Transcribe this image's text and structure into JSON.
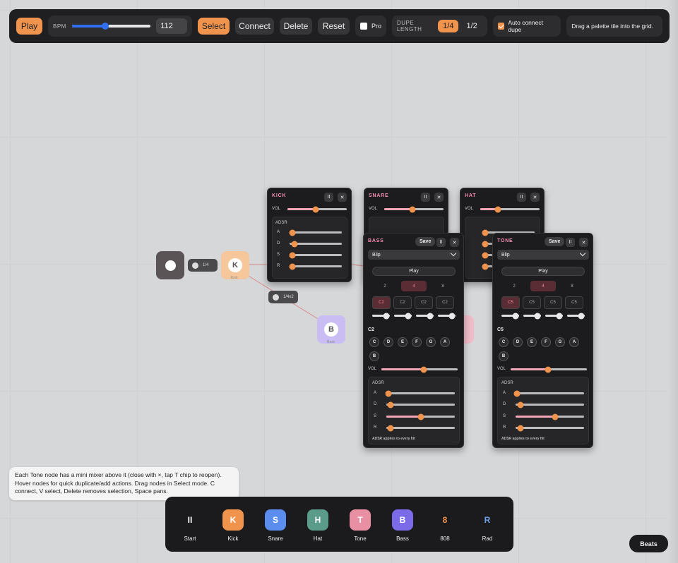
{
  "toolbar": {
    "play_label": "Play",
    "bpm_label": "BPM",
    "bpm_value": "112",
    "bpm_slider_fraction": 0.42,
    "select_label": "Select",
    "connect_label": "Connect",
    "delete_label": "Delete",
    "reset_label": "Reset",
    "pro_label": "Pro",
    "pro_checked": false,
    "dupe_length_label": "DUPE LENGTH",
    "dupe_options": [
      "1/4",
      "1/2"
    ],
    "dupe_selected": "1/4",
    "auto_connect_label": "Auto connect dupe",
    "auto_connect_checked": true,
    "hint_label": "Drag a palette tile into the grid."
  },
  "graph": {
    "start_node_label": "",
    "kick_node_letter": "K",
    "kick_node_label": "Kick",
    "bass_node_letter": "B",
    "bass_node_label": "Bass",
    "chip1_label": "1/4",
    "chip2_label": "1/4x2"
  },
  "mixers": {
    "kick": {
      "title": "KICK",
      "pause": "II",
      "close": "✕",
      "vol_label": "VOL",
      "vol": 0.48,
      "adsr_label": "ADSR",
      "a_label": "A",
      "d_label": "D",
      "s_label": "S",
      "r_label": "R",
      "a": 0.05,
      "d": 0.1,
      "s": 0.05,
      "r": 0.05
    },
    "snare": {
      "title": "SNARE",
      "pause": "II",
      "close": "✕",
      "vol_label": "VOL",
      "vol": 0.48
    },
    "hat": {
      "title": "HAT",
      "pause": "II",
      "close": "✕",
      "vol_label": "VOL",
      "vol": 0.3
    },
    "bass": {
      "title": "BASS",
      "save": "Save",
      "pause": "II",
      "close": "✕",
      "preset": "Blip",
      "play": "Play",
      "lengths": [
        "2",
        "4",
        "8"
      ],
      "length_selected": "4",
      "steps": [
        "C2",
        "C2",
        "C2",
        "C2"
      ],
      "step_active": 0,
      "pitch": "C2",
      "notes": [
        "C",
        "D",
        "E",
        "F",
        "G",
        "A",
        "B"
      ],
      "vol_label": "VOL",
      "vol": 0.56,
      "adsr_label": "ADSR",
      "a_label": "A",
      "d_label": "D",
      "s_label": "S",
      "r_label": "R",
      "a": 0.03,
      "d": 0.06,
      "s": 0.5,
      "r": 0.06,
      "footer": "ADSR applies to every hit"
    },
    "tone": {
      "title": "TONE",
      "save": "Save",
      "pause": "II",
      "close": "✕",
      "preset": "Blip",
      "play": "Play",
      "lengths": [
        "2",
        "4",
        "8"
      ],
      "length_selected": "4",
      "steps": [
        "C5",
        "C5",
        "C5",
        "C5"
      ],
      "step_active": 0,
      "pitch": "C5",
      "notes": [
        "C",
        "D",
        "E",
        "F",
        "G",
        "A",
        "B"
      ],
      "vol_label": "VOL",
      "vol": 0.49,
      "adsr_label": "ADSR",
      "a_label": "A",
      "d_label": "D",
      "s_label": "S",
      "r_label": "R",
      "a": 0.02,
      "d": 0.07,
      "s": 0.58,
      "r": 0.07,
      "footer": "ADSR applies to every hit"
    }
  },
  "help_text": "Each Tone node has a mini mixer above it (close with ×, tap T chip to reopen). Hover nodes for quick duplicate/add actions. Drag nodes in Select mode. C connect, V select, Delete removes selection, Space pans.",
  "palette": {
    "items": [
      {
        "glyph": "II",
        "label": "Start",
        "color": "#1b1b1d",
        "fg": "#ffffff"
      },
      {
        "glyph": "K",
        "label": "Kick",
        "color": "#f0944d",
        "fg": "#ffffff"
      },
      {
        "glyph": "S",
        "label": "Snare",
        "color": "#5b8def",
        "fg": "#ffffff"
      },
      {
        "glyph": "H",
        "label": "Hat",
        "color": "#5b9b8a",
        "fg": "#ffffff"
      },
      {
        "glyph": "T",
        "label": "Tone",
        "color": "#e88fa3",
        "fg": "#ffffff"
      },
      {
        "glyph": "B",
        "label": "Bass",
        "color": "#7b6be8",
        "fg": "#ffffff"
      },
      {
        "glyph": "8",
        "label": "808",
        "color": "#1b1b1d",
        "fg": "#f0944d"
      },
      {
        "glyph": "R",
        "label": "Rad",
        "color": "#1b1b1d",
        "fg": "#6fa0e8"
      }
    ]
  },
  "beats_label": "Beats",
  "colors": {
    "accent": "#f0944d",
    "pink": "#f2a6b8",
    "panel": "#1f1f21"
  }
}
